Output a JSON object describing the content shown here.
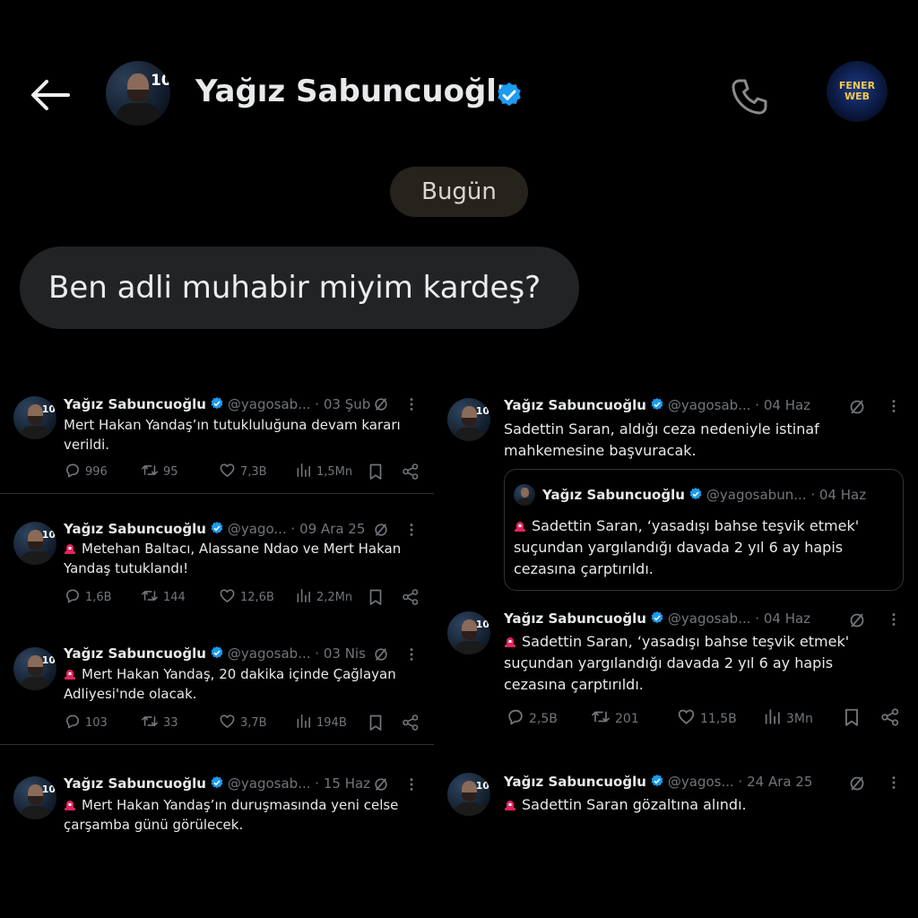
{
  "header": {
    "title": "Yağız Sabuncuoğlu",
    "avatar_tag": "10",
    "logo_line1": "FENER",
    "logo_line2": "WEB"
  },
  "chat": {
    "day_label": "Bugün",
    "message": "Ben adli muhabir miyim kardeş?"
  },
  "colors": {
    "verified": "#1d9bf0",
    "text": "#e7e9ea",
    "muted": "#71767b",
    "siren": "#e0245e"
  },
  "icons": [
    "back-arrow-icon",
    "verified-icon",
    "phone-icon",
    "grok-icon",
    "more-icon",
    "reply-icon",
    "retweet-icon",
    "like-icon",
    "views-icon",
    "bookmark-icon",
    "share-icon",
    "siren-icon"
  ],
  "tweets": [
    {
      "name": "Yağız Sabuncuoğlu",
      "handle": "@yagosab...",
      "sep": "·",
      "date": "03 Şub",
      "line1": "Mert Hakan Yandaş’ın tutukluluğuna devam kararı",
      "line2": "verildi.",
      "replies": "996",
      "retweets": "95",
      "likes": "7,3B",
      "views": "1,5Mn"
    },
    {
      "name": "Yağız Sabuncuoğlu",
      "handle": "@yago...",
      "sep": "·",
      "date": "09 Ara 25",
      "line1": "Metehan Baltacı, Alassane Ndao ve Mert Hakan",
      "line2": "Yandaş tutuklandı!",
      "replies": "1,6B",
      "retweets": "144",
      "likes": "12,6B",
      "views": "2,2Mn"
    },
    {
      "name": "Yağız Sabuncuoğlu",
      "handle": "@yagosab...",
      "sep": "·",
      "date": "03 Nis",
      "line1": "Mert Hakan Yandaş, 20 dakika içinde Çağlayan",
      "line2": "Adliyesi'nde olacak.",
      "replies": "103",
      "retweets": "33",
      "likes": "3,7B",
      "views": "194B"
    },
    {
      "name": "Yağız Sabuncuoğlu",
      "handle": "@yagosab...",
      "sep": "·",
      "date": "15 Haz",
      "line1": "Mert Hakan Yandaş’ın duruşmasında yeni celse",
      "line2": "çarşamba günü görülecek."
    },
    {
      "name": "Yağız Sabuncuoğlu",
      "handle": "@yagosab...",
      "sep": "·",
      "date": "04 Haz",
      "line1": "Sadettin Saran, aldığı ceza nedeniyle istinaf",
      "line2": "mahkemesine başvuracak.",
      "quote": {
        "name": "Yağız Sabuncuoğlu",
        "handle": "@yagosabun...",
        "sep": "·",
        "date": "04 Haz",
        "line1": "Sadettin Saran, ‘yasadışı bahse teşvik etmek'",
        "line2": "suçundan yargılandığı davada 2 yıl 6 ay hapis",
        "line3": "cezasına çarptırıldı."
      }
    },
    {
      "name": "Yağız Sabuncuoğlu",
      "handle": "@yagosab...",
      "sep": "·",
      "date": "04 Haz",
      "line1": "Sadettin Saran, ‘yasadışı bahse teşvik etmek'",
      "line2": "suçundan yargılandığı davada 2 yıl 6 ay hapis",
      "line3": "cezasına çarptırıldı.",
      "replies": "2,5B",
      "retweets": "201",
      "likes": "11,5B",
      "views": "3Mn"
    },
    {
      "name": "Yağız Sabuncuoğlu",
      "handle": "@yagos...",
      "sep": "·",
      "date": "24 Ara 25",
      "line1": "Sadettin Saran gözaltına alındı."
    }
  ]
}
